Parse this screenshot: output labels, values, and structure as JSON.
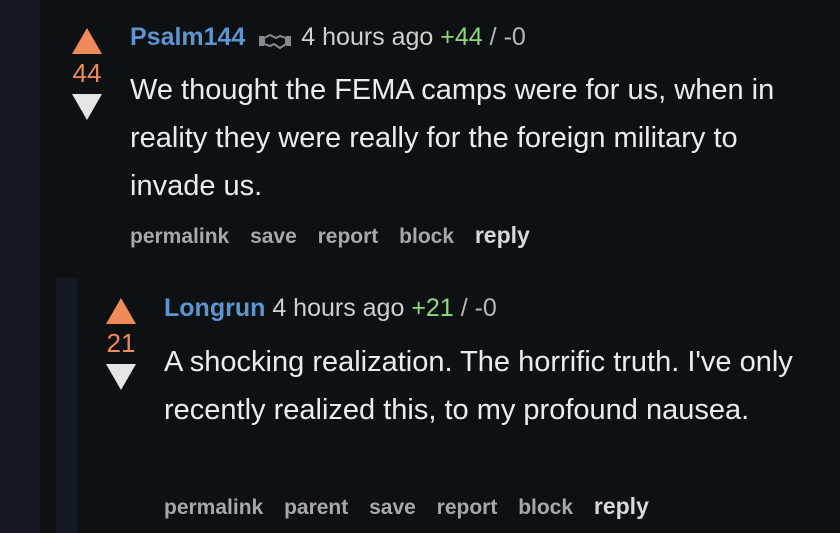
{
  "comments": [
    {
      "author": "Psalm144",
      "time": "4 hours ago",
      "plus": "+44",
      "sep": "/",
      "minus": "-0",
      "score": "44",
      "badge_icon": "handshake-icon",
      "text": "We thought the FEMA camps were for us, when in reality they were really for the foreign military to invade us.",
      "actions": {
        "permalink": "permalink",
        "save": "save",
        "report": "report",
        "block": "block",
        "reply": "reply"
      }
    },
    {
      "author": "Longrun",
      "time": "4 hours ago",
      "plus": "+21",
      "sep": "/",
      "minus": "-0",
      "score": "21",
      "text": "A shocking realization. The horrific truth. I've only recently realized this, to my profound nausea.",
      "actions": {
        "permalink": "permalink",
        "parent": "parent",
        "save": "save",
        "report": "report",
        "block": "block",
        "reply": "reply"
      }
    }
  ],
  "colors": {
    "background": "#0e1114",
    "upvote": "#f08a58",
    "author": "#5d95cf",
    "plus": "#8fd77d"
  }
}
